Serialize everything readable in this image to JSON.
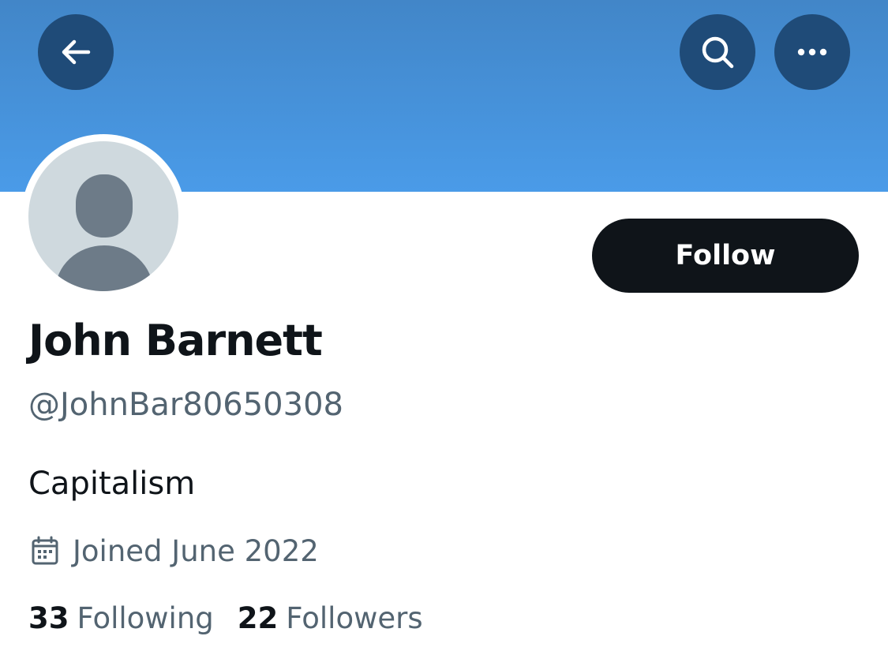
{
  "profile": {
    "display_name": "John Barnett",
    "handle": "@JohnBar80650308",
    "bio": "Capitalism",
    "joined": "Joined June 2022"
  },
  "actions": {
    "follow_label": "Follow"
  },
  "stats": {
    "following_count": "33",
    "following_label": "Following",
    "followers_count": "22",
    "followers_label": "Followers"
  },
  "icons": {
    "back": "arrow-left-icon",
    "search": "search-icon",
    "more": "more-horizontal-icon",
    "calendar": "calendar-icon",
    "avatar": "default-avatar-icon"
  },
  "colors": {
    "banner": "#4a9be8",
    "header_button": "#1f4b78",
    "follow_button": "#0f1419",
    "primary_text": "#0f1419",
    "secondary_text": "#536471",
    "avatar_background": "#cfd9de",
    "avatar_silhouette": "#6d7b88"
  }
}
